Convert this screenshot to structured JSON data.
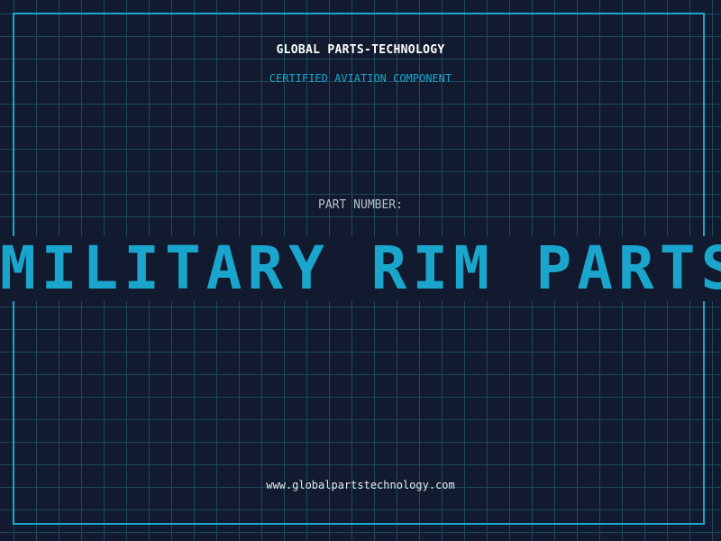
{
  "header": {
    "company": "GLOBAL PARTS-TECHNOLOGY",
    "subtitle": "CERTIFIED AVIATION COMPONENT"
  },
  "part": {
    "label": "PART NUMBER:",
    "value": "MILITARY RIM PARTS"
  },
  "footer": {
    "website": "www.globalpartstechnology.com"
  },
  "colors": {
    "background": "#111a2e",
    "grid": "#1d4a5c",
    "accent": "#1aa6cc",
    "text": "#ffffff",
    "muted_text": "#b8c0cc"
  }
}
